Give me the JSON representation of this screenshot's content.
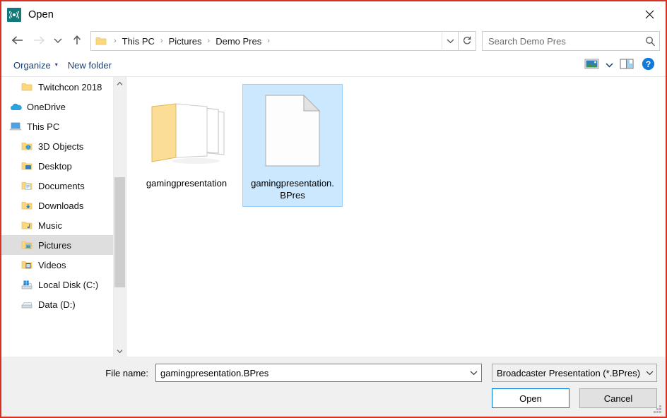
{
  "window": {
    "title": "Open",
    "app_icon": "broadcast-icon",
    "close_label": "✕",
    "border_color": "#d93025"
  },
  "navbar": {
    "back_icon": "arrow-left-icon",
    "forward_icon": "arrow-right-icon",
    "recent_icon": "chevron-down-icon",
    "up_icon": "arrow-up-icon",
    "breadcrumb": [
      "This PC",
      "Pictures",
      "Demo Pres"
    ],
    "separator": "›",
    "dropdown_icon": "chevron-down-icon",
    "refresh_icon": "refresh-icon"
  },
  "search": {
    "placeholder": "Search Demo Pres",
    "value": "",
    "icon": "search-icon"
  },
  "command_bar": {
    "organize_label": "Organize",
    "organize_caret": "▾",
    "new_folder_label": "New folder",
    "view_icon": "picture-view-icon",
    "view_caret": "▾",
    "preview_pane_icon": "preview-pane-icon",
    "help_icon": "help-icon"
  },
  "sidebar": {
    "items": [
      {
        "label": "Twitchcon 2018",
        "icon": "folder-icon",
        "indent": 1,
        "selected": false
      },
      {
        "label": "OneDrive",
        "icon": "onedrive-icon",
        "indent": 0,
        "selected": false
      },
      {
        "label": "This PC",
        "icon": "computer-icon",
        "indent": 0,
        "selected": false
      },
      {
        "label": "3D Objects",
        "icon": "folder-3d-icon",
        "indent": 1,
        "selected": false
      },
      {
        "label": "Desktop",
        "icon": "folder-desktop-icon",
        "indent": 1,
        "selected": false
      },
      {
        "label": "Documents",
        "icon": "folder-documents-icon",
        "indent": 1,
        "selected": false
      },
      {
        "label": "Downloads",
        "icon": "folder-downloads-icon",
        "indent": 1,
        "selected": false
      },
      {
        "label": "Music",
        "icon": "folder-music-icon",
        "indent": 1,
        "selected": false
      },
      {
        "label": "Pictures",
        "icon": "folder-pictures-icon",
        "indent": 1,
        "selected": true
      },
      {
        "label": "Videos",
        "icon": "folder-videos-icon",
        "indent": 1,
        "selected": false
      },
      {
        "label": "Local Disk (C:)",
        "icon": "drive-windows-icon",
        "indent": 1,
        "selected": false
      },
      {
        "label": "Data (D:)",
        "icon": "drive-icon",
        "indent": 1,
        "selected": false
      }
    ],
    "scroll_up_icon": "chevron-up-icon",
    "scroll_down_icon": "chevron-down-icon"
  },
  "files": {
    "items": [
      {
        "name": "gamingpresentation",
        "icon": "folder-open-icon",
        "selected": false
      },
      {
        "name": "gamingpresentation.BPres",
        "icon": "document-file-icon",
        "selected": true
      }
    ],
    "selection_color": "#cce8ff"
  },
  "footer": {
    "filename_label": "File name:",
    "filename_value": "gamingpresentation.BPres",
    "filename_chevron": "chevron-down-icon",
    "filetype_value": "Broadcaster Presentation (*.BPres)",
    "filetype_chevron": "chevron-down-icon",
    "open_label": "Open",
    "cancel_label": "Cancel",
    "accent_color": "#0078d7"
  }
}
